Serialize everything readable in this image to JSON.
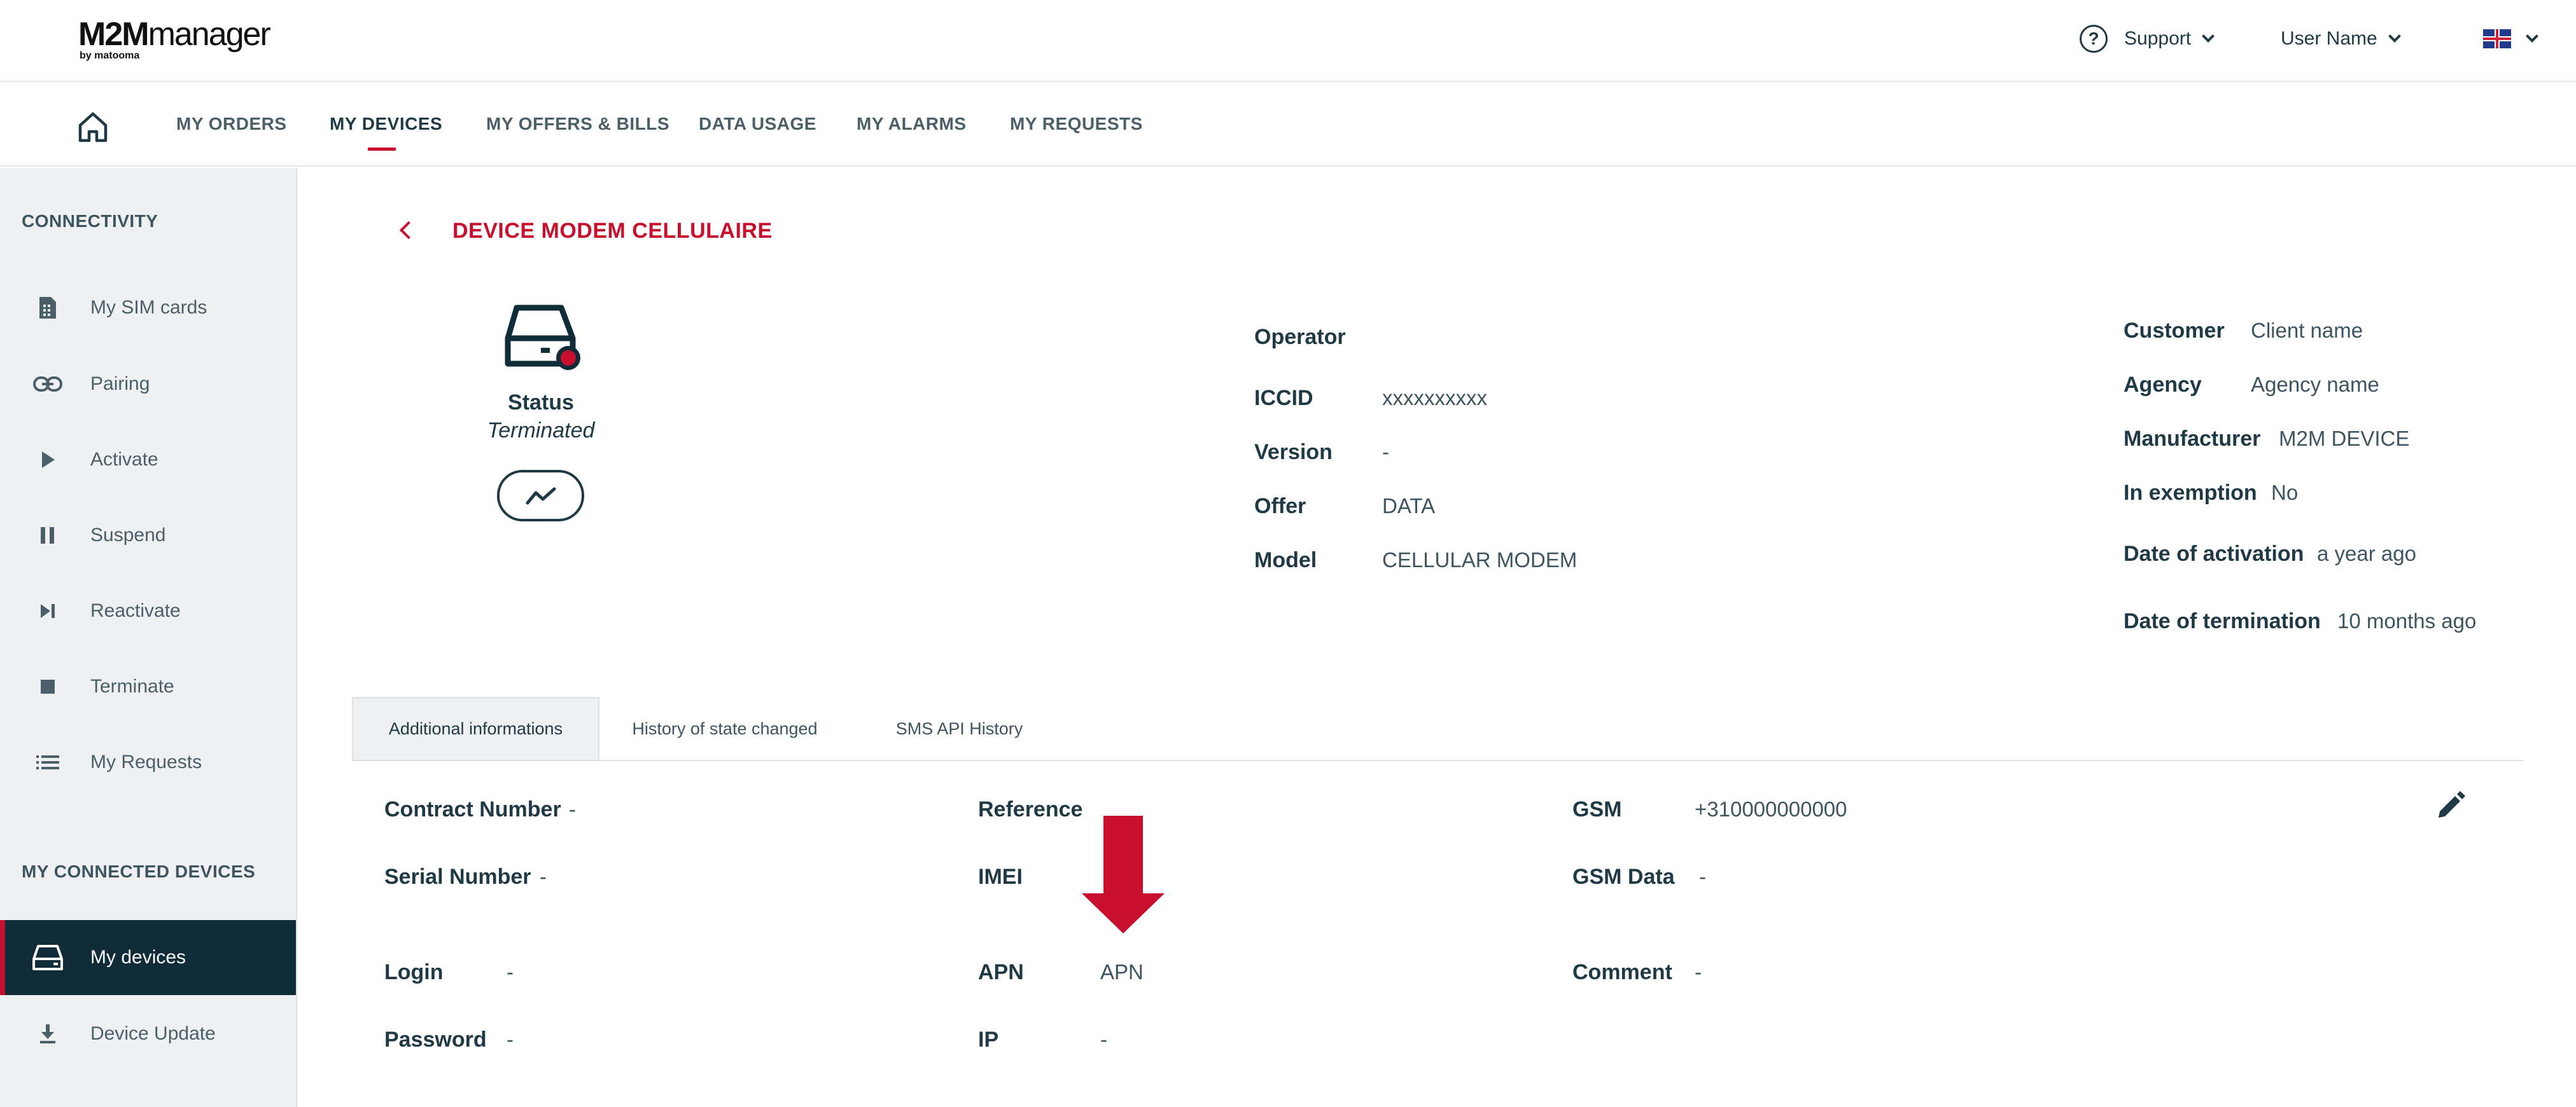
{
  "header": {
    "logo_main": "M2Mmanager",
    "logo_sub": "by matooma",
    "support_label": "Support",
    "user_label": "User Name",
    "language_icon": "uk-flag-icon"
  },
  "nav": {
    "home_icon": "home-icon",
    "items": [
      {
        "label": "MY ORDERS"
      },
      {
        "label": "MY DEVICES"
      },
      {
        "label": "MY OFFERS & BILLS"
      },
      {
        "label": "DATA USAGE"
      },
      {
        "label": "MY ALARMS"
      },
      {
        "label": "MY REQUESTS"
      }
    ],
    "active_index": 1
  },
  "sidebar": {
    "section_connectivity": "CONNECTIVITY",
    "connectivity_items": [
      {
        "label": "My SIM cards",
        "icon": "sim-card-icon"
      },
      {
        "label": "Pairing",
        "icon": "link-icon"
      },
      {
        "label": "Activate",
        "icon": "play-icon"
      },
      {
        "label": "Suspend",
        "icon": "pause-icon"
      },
      {
        "label": "Reactivate",
        "icon": "skip-next-icon"
      },
      {
        "label": "Terminate",
        "icon": "stop-icon"
      },
      {
        "label": "My Requests",
        "icon": "list-icon"
      }
    ],
    "section_devices": "MY CONNECTED DEVICES",
    "device_items": [
      {
        "label": "My devices",
        "icon": "device-icon"
      },
      {
        "label": "Device Update",
        "icon": "download-icon"
      }
    ]
  },
  "main": {
    "title": "DEVICE MODEM CELLULAIRE",
    "status_label": "Status",
    "status_value": "Terminated",
    "details": {
      "operator_label": "Operator",
      "iccid_label": "ICCID",
      "iccid_value": "xxxxxxxxxx",
      "version_label": "Version",
      "version_value": "-",
      "offer_label": "Offer",
      "offer_value": "DATA",
      "model_label": "Model",
      "model_value": "CELLULAR MODEM"
    },
    "customer": {
      "customer_label": "Customer",
      "customer_value": "Client name",
      "agency_label": "Agency",
      "agency_value": "Agency name",
      "manufacturer_label": "Manufacturer",
      "manufacturer_value": "M2M DEVICE",
      "exemption_label": "In exemption",
      "exemption_value": "No",
      "activation_label": "Date of activation",
      "activation_value": "a year ago",
      "termination_label": "Date of termination",
      "termination_value": "10 months ago"
    },
    "tabs": [
      {
        "label": "Additional informations"
      },
      {
        "label": "History of state changed"
      },
      {
        "label": "SMS API History"
      }
    ],
    "additional": {
      "contract_label": "Contract Number",
      "contract_value": "-",
      "serial_label": "Serial Number",
      "serial_value": "-",
      "login_label": "Login",
      "login_value": "-",
      "password_label": "Password",
      "password_value": "-",
      "reference_label": "Reference",
      "imei_label": "IMEI",
      "apn_label": "APN",
      "apn_value": "APN",
      "ip_label": "IP",
      "ip_value": "-",
      "gsm_label": "GSM",
      "gsm_value": "+310000000000",
      "gsm_data_label": "GSM Data",
      "gsm_data_value": "-",
      "comment_label": "Comment",
      "comment_value": "-"
    }
  },
  "colors": {
    "accent": "#c8102e",
    "dark": "#0f2c38",
    "text": "#1f3a45",
    "sidebar_bg": "#eef0f1"
  }
}
